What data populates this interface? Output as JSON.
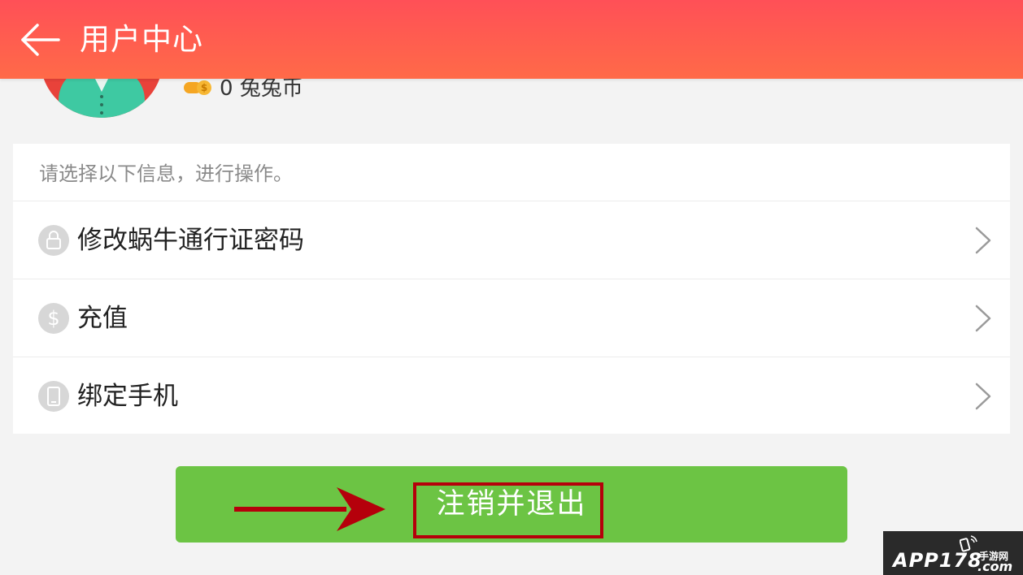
{
  "header": {
    "title": "用户中心",
    "gradient_top": "#ff5057",
    "gradient_bottom": "#ff6a48"
  },
  "profile": {
    "coin_text": "0 兔兔币"
  },
  "menu": {
    "hint": "请选择以下信息，进行操作。",
    "items": [
      {
        "label": "修改蜗牛通行证密码",
        "icon": "lock-icon"
      },
      {
        "label": "充值",
        "icon": "dollar-icon"
      },
      {
        "label": "绑定手机",
        "icon": "phone-icon"
      }
    ]
  },
  "logout": {
    "label": "注销并退出",
    "color": "#6cc444"
  },
  "annotation": {
    "arrow_color": "#b5000b"
  },
  "watermark": {
    "main": "APP178",
    "cn": "手游网",
    "com": ".com"
  }
}
